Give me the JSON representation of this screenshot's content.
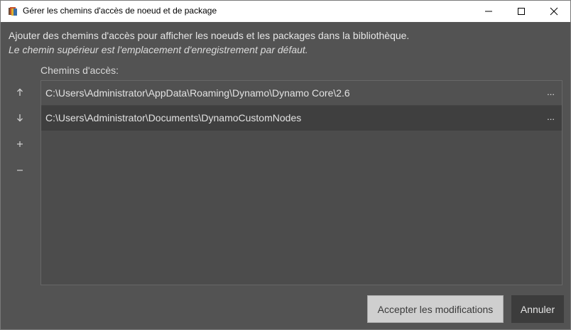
{
  "window": {
    "title": "Gérer les chemins d'accès de noeud et de package",
    "icon": "dynamo-app-icon",
    "controls": [
      "minimize-icon",
      "maximize-icon",
      "close-icon"
    ]
  },
  "intro": {
    "text": "Ajouter des chemins d'accès pour afficher les noeuds et les packages dans la bibliothèque.",
    "note": "Le chemin supérieur est l'emplacement d'enregistrement par défaut."
  },
  "paths": {
    "label": "Chemins d'accès:",
    "items": [
      {
        "path": "C:\\Users\\Administrator\\AppData\\Roaming\\Dynamo\\Dynamo Core\\2.6",
        "browse": "..."
      },
      {
        "path": "C:\\Users\\Administrator\\Documents\\DynamoCustomNodes",
        "browse": "..."
      }
    ]
  },
  "side_buttons": {
    "up": "↑",
    "down": "↓",
    "add": "+",
    "remove": "−"
  },
  "footer": {
    "accept_label": "Accepter les modifications",
    "cancel_label": "Annuler"
  },
  "colors": {
    "background": "#535353",
    "selected_row": "#3f3f3f",
    "accept_button": "#cfcfcf",
    "cancel_button": "#3c3c3c"
  }
}
